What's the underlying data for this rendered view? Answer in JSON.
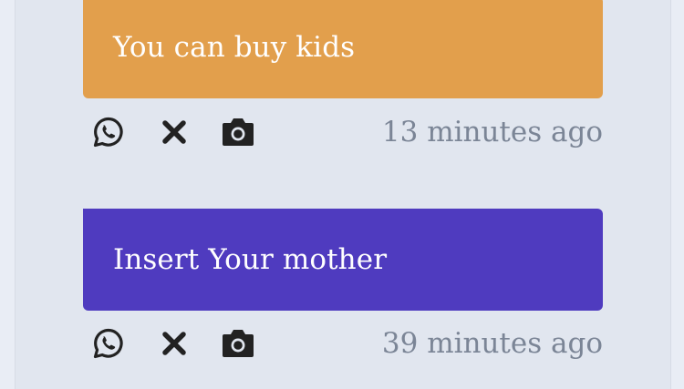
{
  "posts": [
    {
      "text": "You can buy kids",
      "color": "#e29f4c",
      "time": "13 minutes ago",
      "actions": [
        "whatsapp-icon",
        "close-icon",
        "camera-icon"
      ]
    },
    {
      "text": "Insert Your mother",
      "color": "#4f3bbf",
      "time": "39 minutes ago",
      "actions": [
        "whatsapp-icon",
        "close-icon",
        "camera-icon"
      ]
    }
  ],
  "colors": {
    "icon": "#222222",
    "timestamp": "#7b8596",
    "background": "#e1e6ef"
  }
}
